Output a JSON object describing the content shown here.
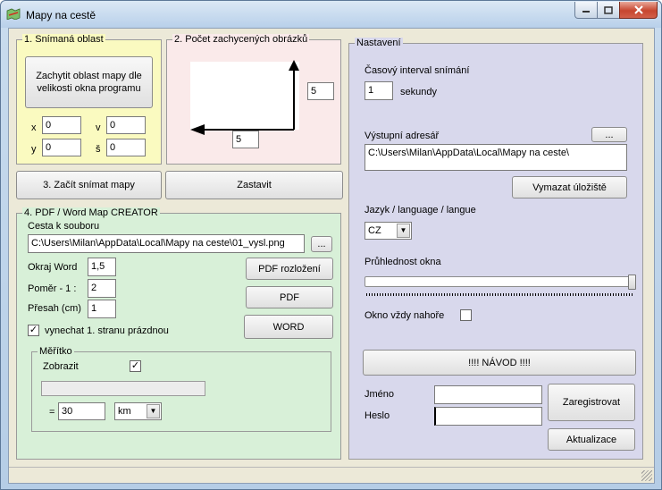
{
  "window": {
    "title": "Mapy na cestě"
  },
  "capture": {
    "legend": "1. Snímaná oblast",
    "capture_button": "Zachytit oblast mapy dle velikosti okna programu",
    "x_label": "x",
    "x_value": "0",
    "y_label": "y",
    "y_value": "0",
    "v_label": "v",
    "v_value": "0",
    "s_label": "š",
    "s_value": "0"
  },
  "count": {
    "legend": "2. Počet zachycených obrázků",
    "vertical_value": "5",
    "horizontal_value": "5"
  },
  "actions": {
    "start_button": "3. Začít snímat mapy",
    "stop_button": "Zastavit"
  },
  "pdf": {
    "legend": "4. PDF / Word Map CREATOR",
    "path_label": "Cesta k souboru",
    "path_value": "C:\\Users\\Milan\\AppData\\Local\\Mapy na ceste\\01_vysl.png",
    "browse_button": "...",
    "okraj_label": "Okraj Word",
    "okraj_value": "1,5",
    "pomer_label": "Poměr - 1 :",
    "pomer_value": "2",
    "presah_label": "Přesah (cm)",
    "presah_value": "1",
    "pdf_layout_button": "PDF rozložení",
    "pdf_button": "PDF",
    "word_button": "WORD",
    "skip_first_label": "vynechat 1. stranu prázdnou",
    "skip_first_checked": true,
    "scale": {
      "legend": "Měřítko",
      "show_label": "Zobrazit",
      "show_checked": true,
      "equals": "=",
      "value": "30",
      "unit": "km"
    }
  },
  "settings": {
    "legend": "Nastavení",
    "interval_label": "Časový interval snímání",
    "interval_value": "1",
    "interval_unit": "sekundy",
    "output_label": "Výstupní adresář",
    "output_browse": "...",
    "output_value": "C:\\Users\\Milan\\AppData\\Local\\Mapy na ceste\\",
    "clear_storage_button": "Vymazat úložiště",
    "language_label": "Jazyk / language / langue",
    "language_value": "CZ",
    "transparency_label": "Průhlednost okna",
    "transparency_level": 1.0,
    "always_on_top_label": "Okno vždy nahoře",
    "always_on_top_checked": false,
    "guide_button": "!!!!    NÁVOD    !!!!",
    "name_label": "Jméno",
    "name_value": "",
    "password_label": "Heslo",
    "password_value": "",
    "register_button": "Zaregistrovat",
    "update_button": "Aktualizace"
  },
  "colors": {
    "capture_bg": "#fafac0",
    "count_bg": "#faeaea",
    "pdf_bg": "#d8f0d8",
    "settings_bg": "#d8d8ec"
  }
}
